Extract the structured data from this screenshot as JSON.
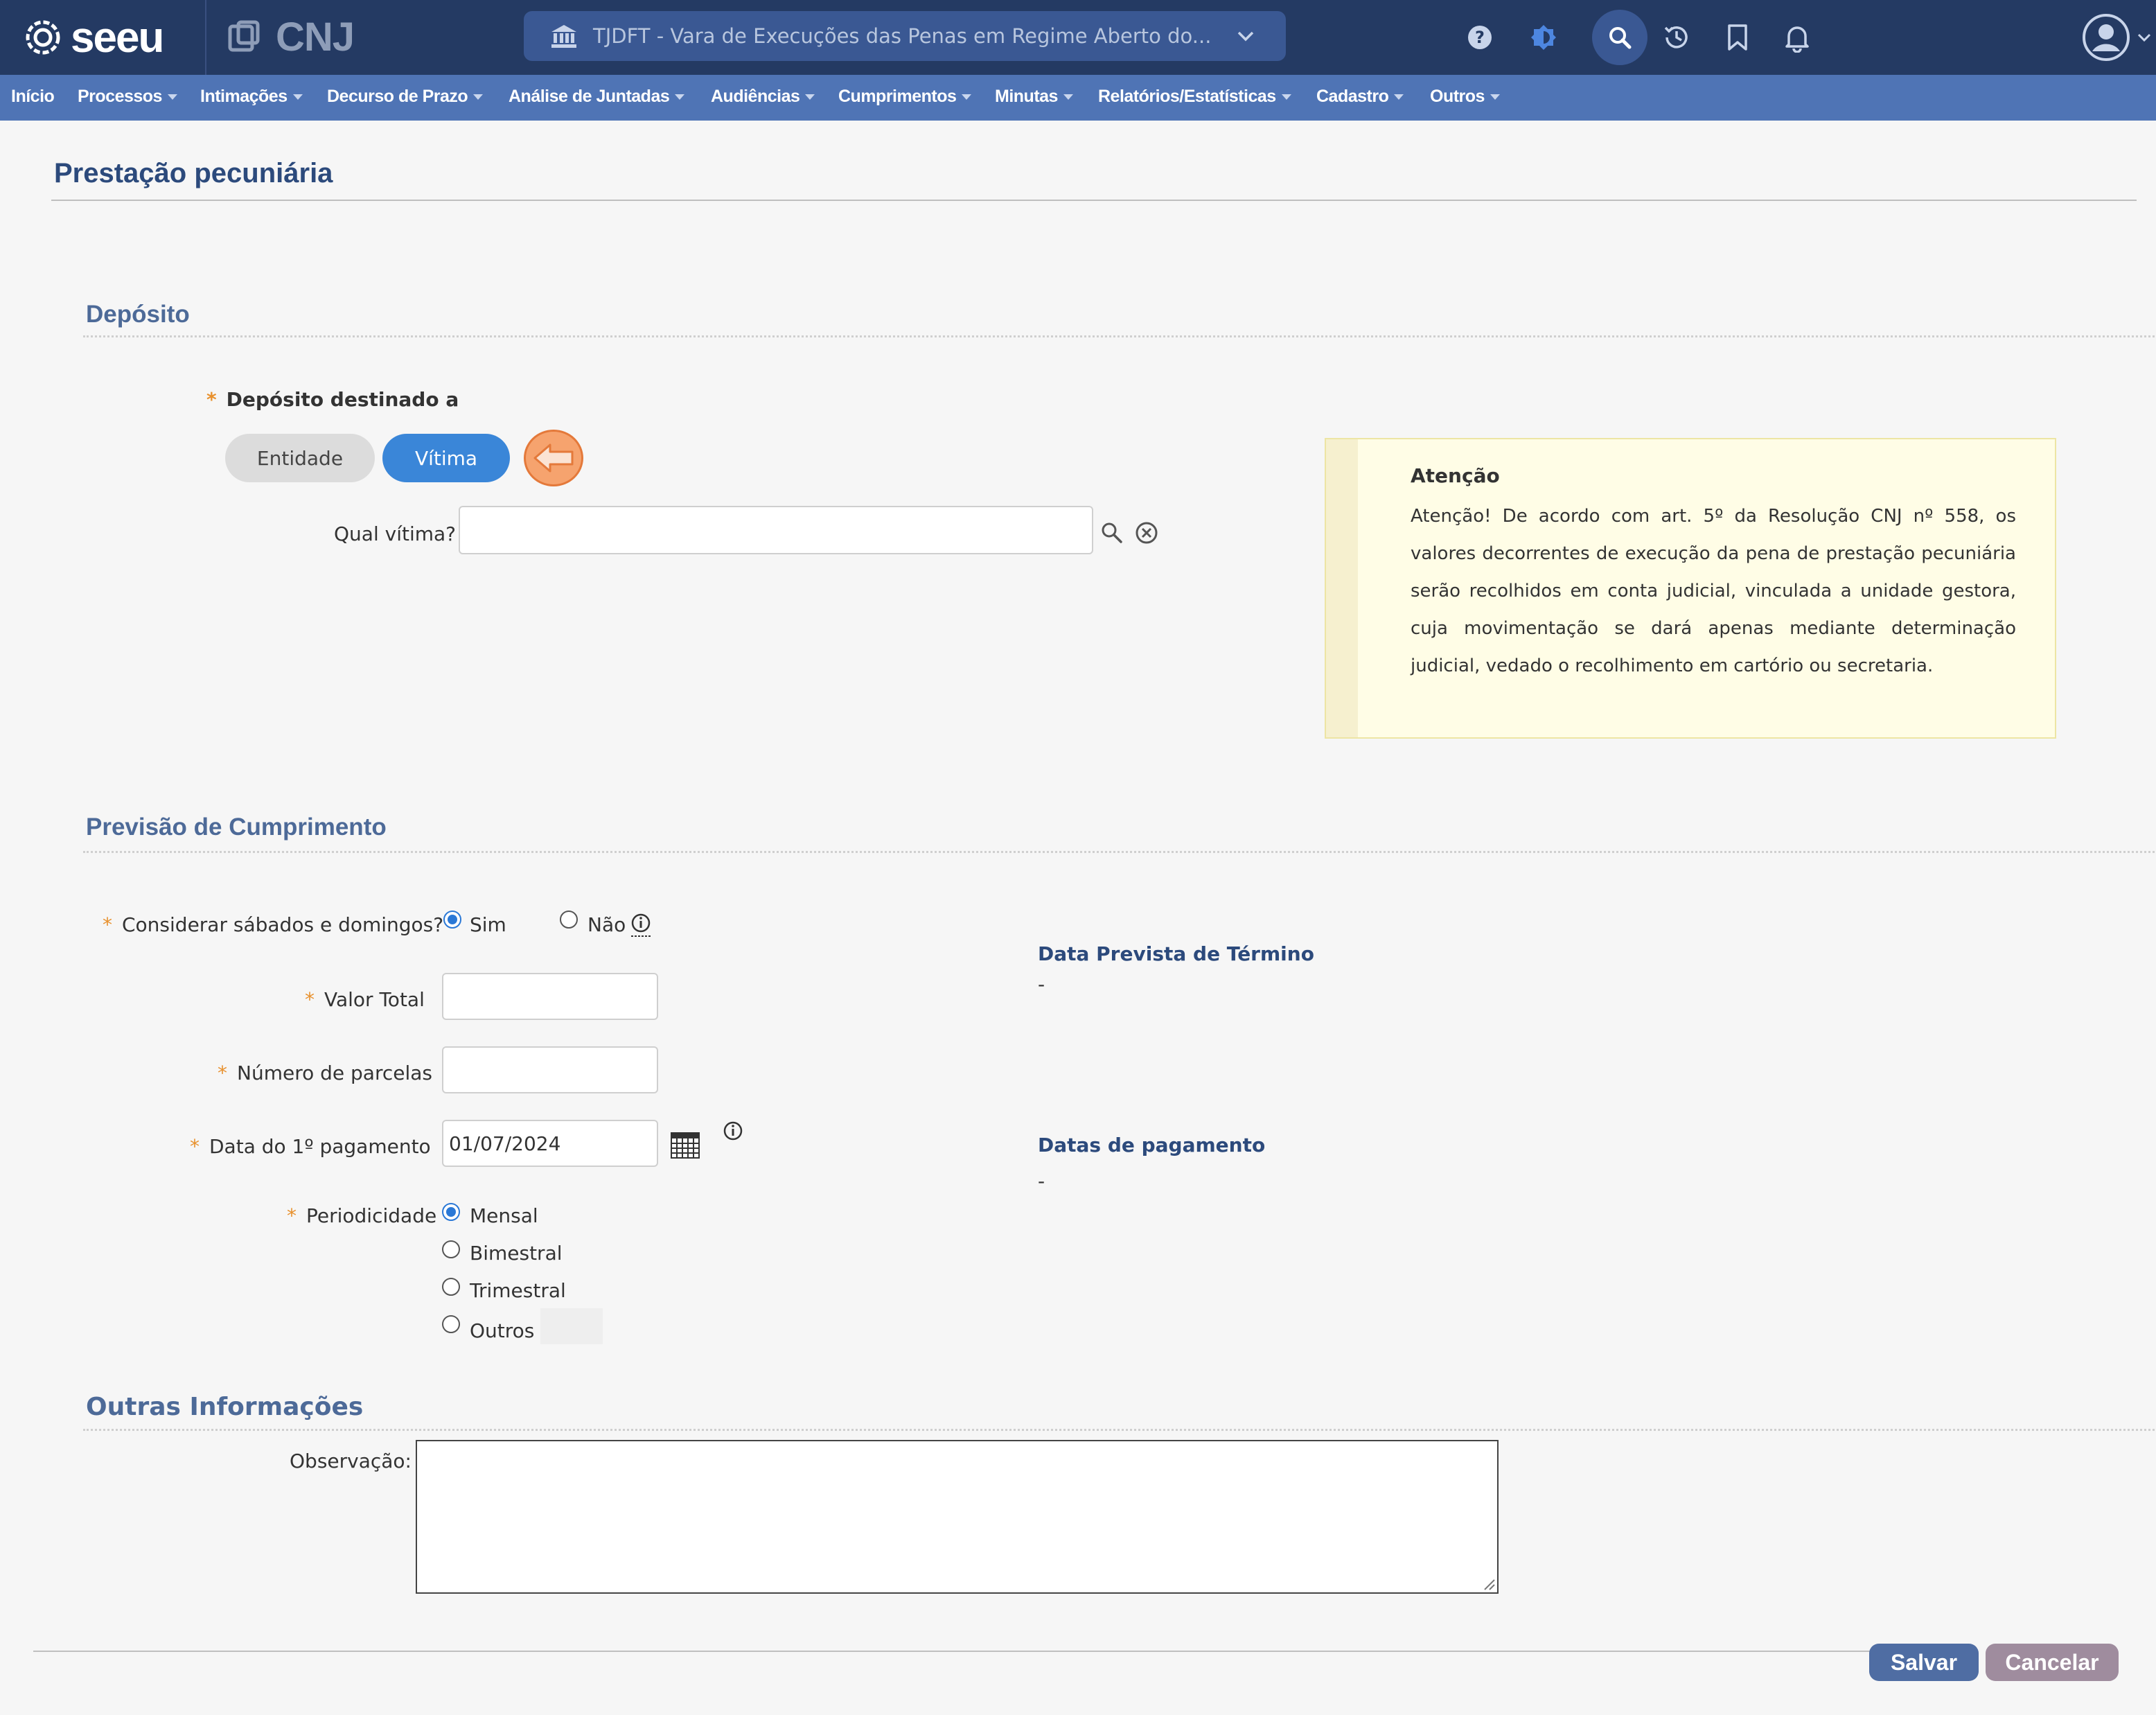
{
  "app": {
    "logo_text": "seeu",
    "partner_logo_text": "CNJ",
    "court_selector": "TJDFT - Vara de Execuções das Penas em Regime Aberto do..."
  },
  "menu": [
    {
      "label": "Início",
      "has_caret": false
    },
    {
      "label": "Processos",
      "has_caret": true
    },
    {
      "label": "Intimações",
      "has_caret": true
    },
    {
      "label": "Decurso de Prazo",
      "has_caret": true
    },
    {
      "label": "Análise de Juntadas",
      "has_caret": true
    },
    {
      "label": "Audiências",
      "has_caret": true
    },
    {
      "label": "Cumprimentos",
      "has_caret": true
    },
    {
      "label": "Minutas",
      "has_caret": true
    },
    {
      "label": "Relatórios/Estatísticas",
      "has_caret": true
    },
    {
      "label": "Cadastro",
      "has_caret": true
    },
    {
      "label": "Outros",
      "has_caret": true
    }
  ],
  "page": {
    "title": "Prestação pecuniária"
  },
  "deposito": {
    "section_title": "Depósito",
    "label": "Depósito destinado a",
    "option_entidade": "Entidade",
    "option_vitima": "Vítima",
    "selected": "Vítima",
    "qual_vitima_label": "Qual vítima?",
    "qual_vitima_value": ""
  },
  "attention": {
    "heading": "Atenção",
    "text": "Atenção! De acordo com art. 5º da Resolução CNJ nº 558, os valores decorrentes de execução da pena de prestação pecuniária serão recolhidos em conta judicial, vinculada a unidade gestora, cuja movimentação se dará apenas mediante determinação judicial, vedado o recolhimento em cartório ou secretaria."
  },
  "previsao": {
    "section_title": "Previsão de Cumprimento",
    "weekends_label": "Considerar sábados e domingos?",
    "weekends_sim": "Sim",
    "weekends_nao": "Não",
    "weekends_selected": "Sim",
    "valor_total_label": "Valor Total",
    "valor_total_value": "",
    "parcelas_label": "Número de parcelas",
    "parcelas_value": "",
    "data_label": "Data do 1º pagamento",
    "data_value": "01/07/2024",
    "periodicidade_label": "Periodicidade",
    "periodicidade_options": [
      "Mensal",
      "Bimestral",
      "Trimestral",
      "Outros"
    ],
    "periodicidade_selected": "Mensal",
    "data_prevista_heading": "Data Prevista de Término",
    "data_prevista_value": "-",
    "datas_pagamento_heading": "Datas de pagamento",
    "datas_pagamento_value": "-"
  },
  "outras": {
    "section_title": "Outras Informações",
    "observacao_label": "Observação:",
    "observacao_value": ""
  },
  "actions": {
    "save": "Salvar",
    "cancel": "Cancelar"
  },
  "colors": {
    "topbar": "#243a63",
    "menubar": "#4f74b5",
    "accent": "#3a86d8",
    "required": "#e8912e"
  }
}
